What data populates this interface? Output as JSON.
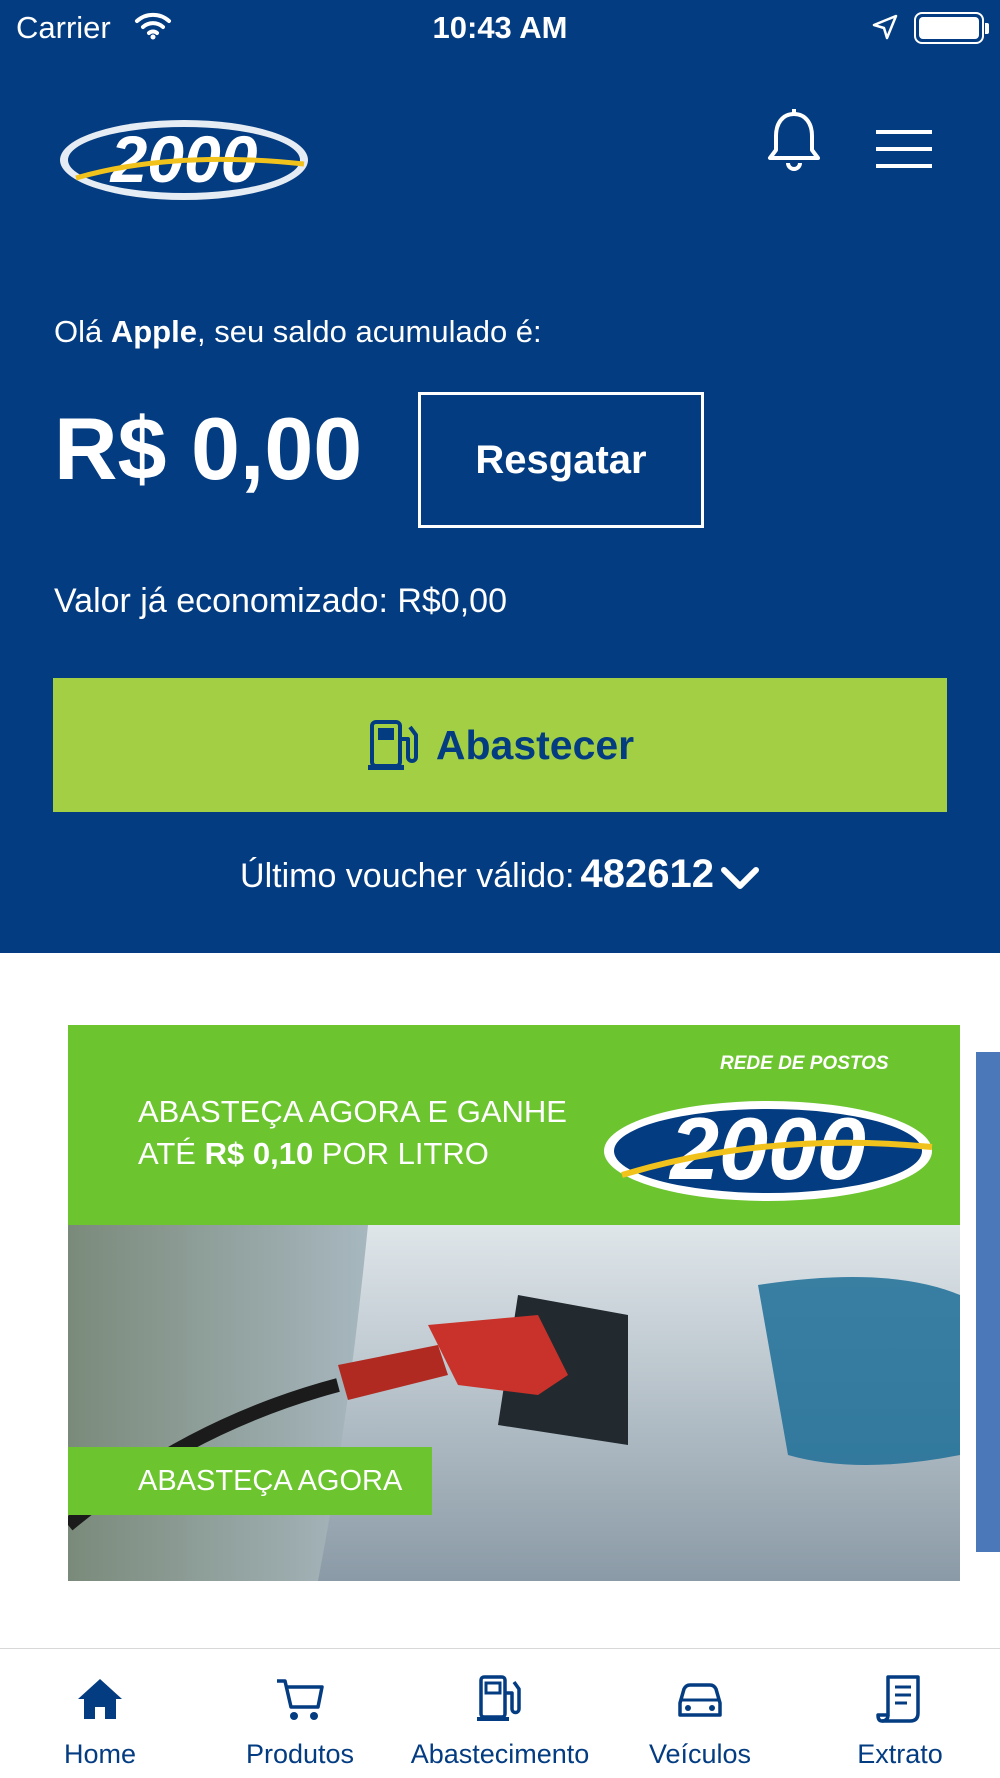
{
  "status_bar": {
    "carrier": "Carrier",
    "time": "10:43 AM"
  },
  "colors": {
    "brand_blue": "#043c82",
    "accent_green": "#a2cf43",
    "banner_green": "#6cc52e"
  },
  "header": {
    "logo_text": "2000",
    "icons": [
      "bell-icon",
      "hamburger-menu-icon"
    ]
  },
  "account": {
    "greeting_prefix": "Olá ",
    "user_name": "Apple",
    "greeting_suffix": ", seu saldo acumulado é:",
    "balance": "R$ 0,00",
    "redeem_label": "Resgatar",
    "saved_text": "Valor já economizado: R$0,00"
  },
  "fuel_button": {
    "label": "Abastecer",
    "icon": "fuel-pump-icon"
  },
  "voucher": {
    "label": "Último voucher válido:",
    "code": "482612",
    "icon": "chevron-down-icon"
  },
  "banner": {
    "line1": "ABASTEÇA AGORA E GANHE",
    "line2_prefix": "ATÉ ",
    "line2_bold": "R$ 0,10",
    "line2_suffix": " POR LITRO",
    "network_label": "REDE DE POSTOS",
    "logo_text": "2000",
    "cta": "ABASTEÇA AGORA"
  },
  "tabbar": {
    "items": [
      {
        "label": "Home",
        "icon": "home-icon"
      },
      {
        "label": "Produtos",
        "icon": "cart-icon"
      },
      {
        "label": "Abastecimento",
        "icon": "fuel-pump-icon"
      },
      {
        "label": "Veículos",
        "icon": "car-icon"
      },
      {
        "label": "Extrato",
        "icon": "receipt-icon"
      }
    ]
  }
}
